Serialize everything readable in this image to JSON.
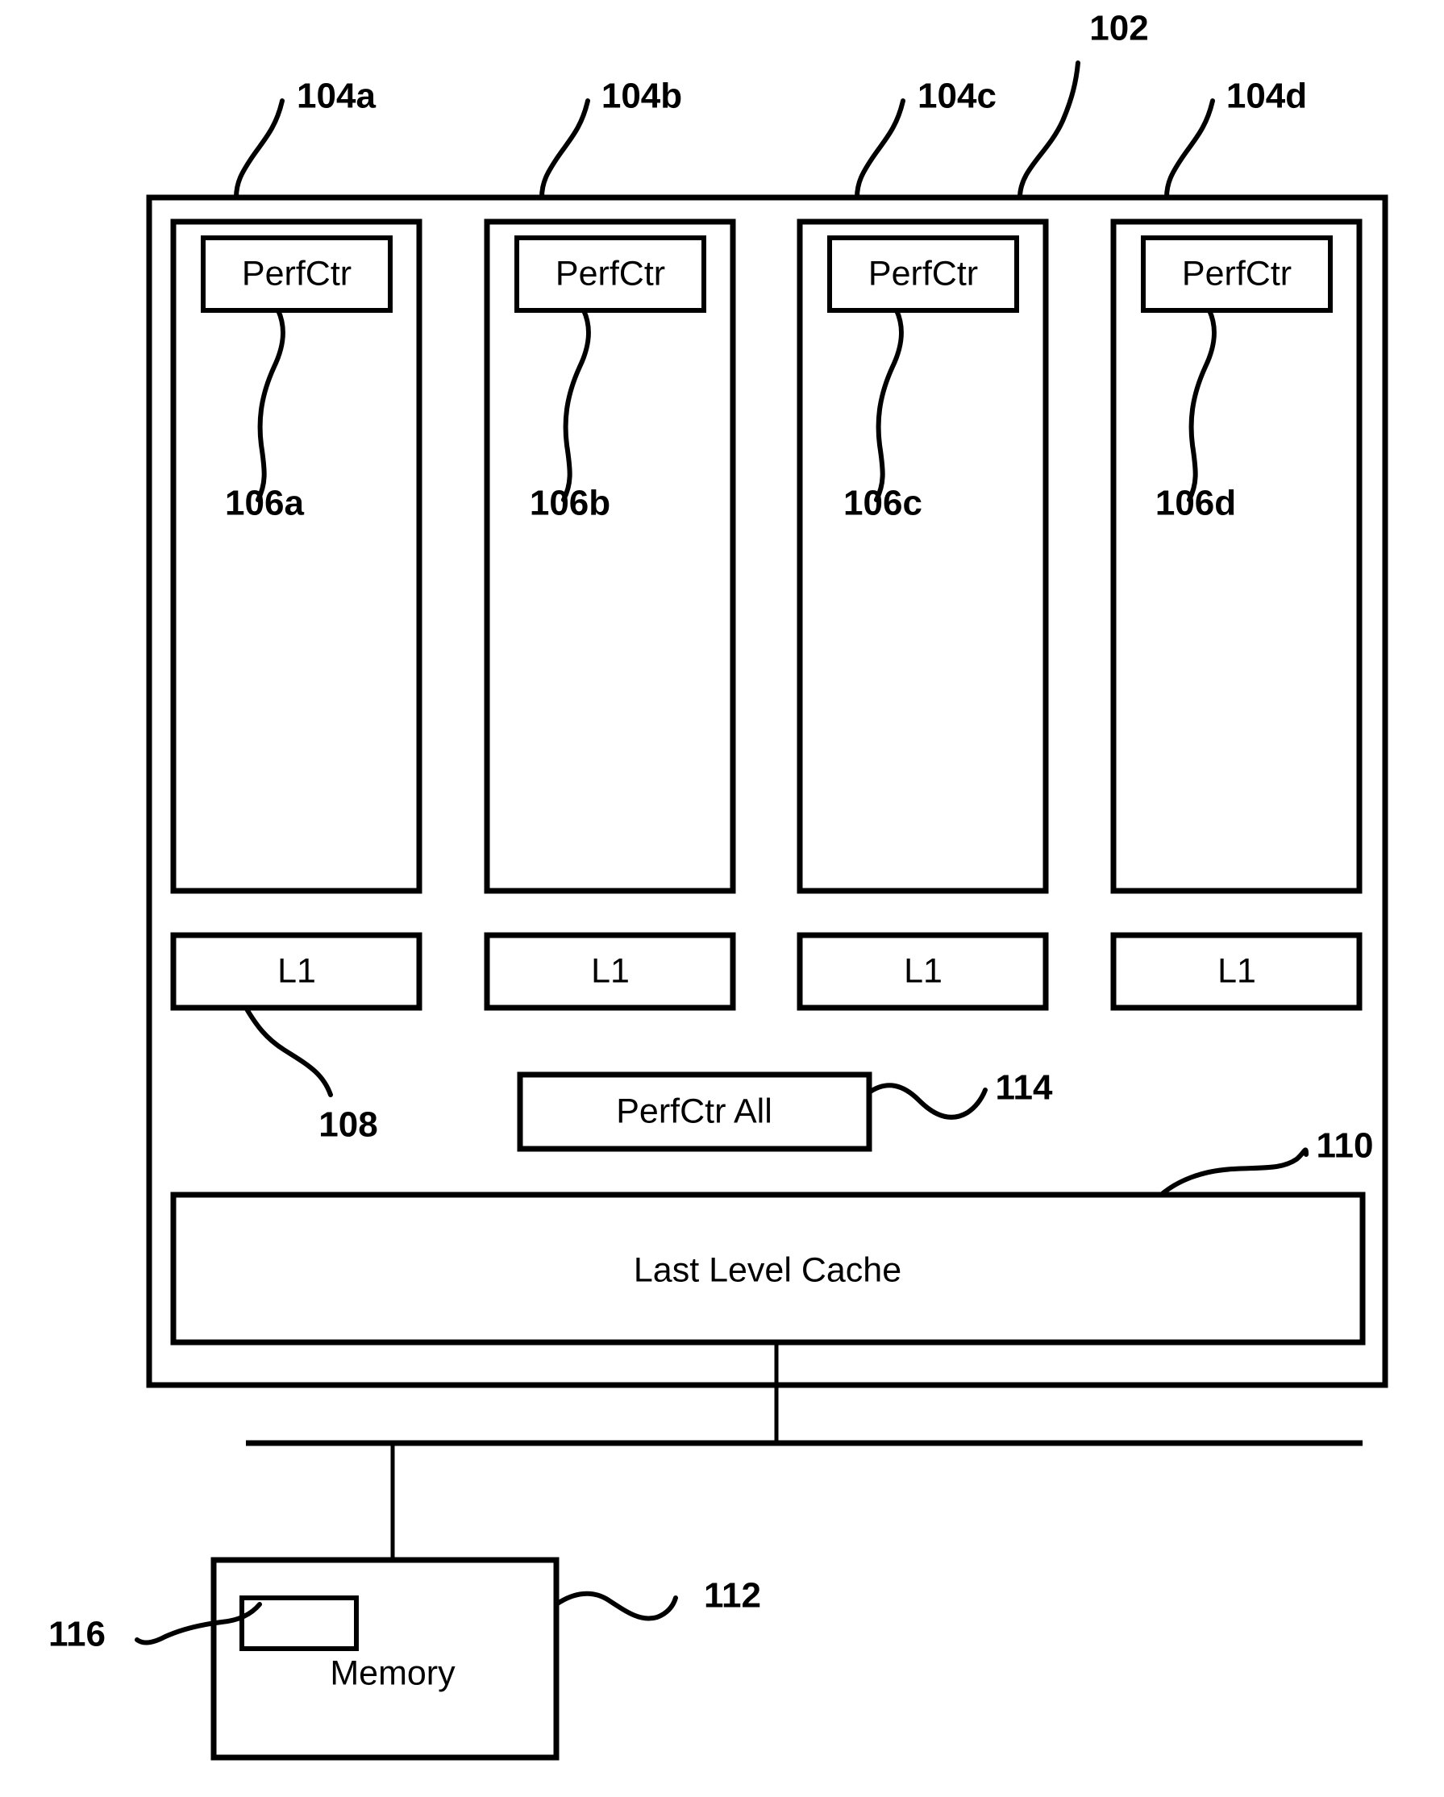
{
  "figure": {
    "kind": "patent-block-diagram",
    "background_color": "#ffffff",
    "line_color": "#000000"
  },
  "chip": {
    "ref": "102",
    "label": ""
  },
  "cores": [
    {
      "ref": "104a",
      "perfctr_ref": "106a",
      "perfctr_label": "PerfCtr",
      "l1_label": "L1"
    },
    {
      "ref": "104b",
      "perfctr_ref": "106b",
      "perfctr_label": "PerfCtr",
      "l1_label": "L1"
    },
    {
      "ref": "104c",
      "perfctr_ref": "106c",
      "perfctr_label": "PerfCtr",
      "l1_label": "L1"
    },
    {
      "ref": "104d",
      "perfctr_ref": "106d",
      "perfctr_label": "PerfCtr",
      "l1_label": "L1"
    }
  ],
  "l1_cache": {
    "ref": "108",
    "label": "L1"
  },
  "perfctr_all": {
    "ref": "114",
    "label": "PerfCtr All"
  },
  "last_level_cache": {
    "ref": "110",
    "label": "Last Level Cache"
  },
  "memory": {
    "ref": "112",
    "label": "Memory",
    "inner_block_ref": "116",
    "inner_block_label": ""
  }
}
